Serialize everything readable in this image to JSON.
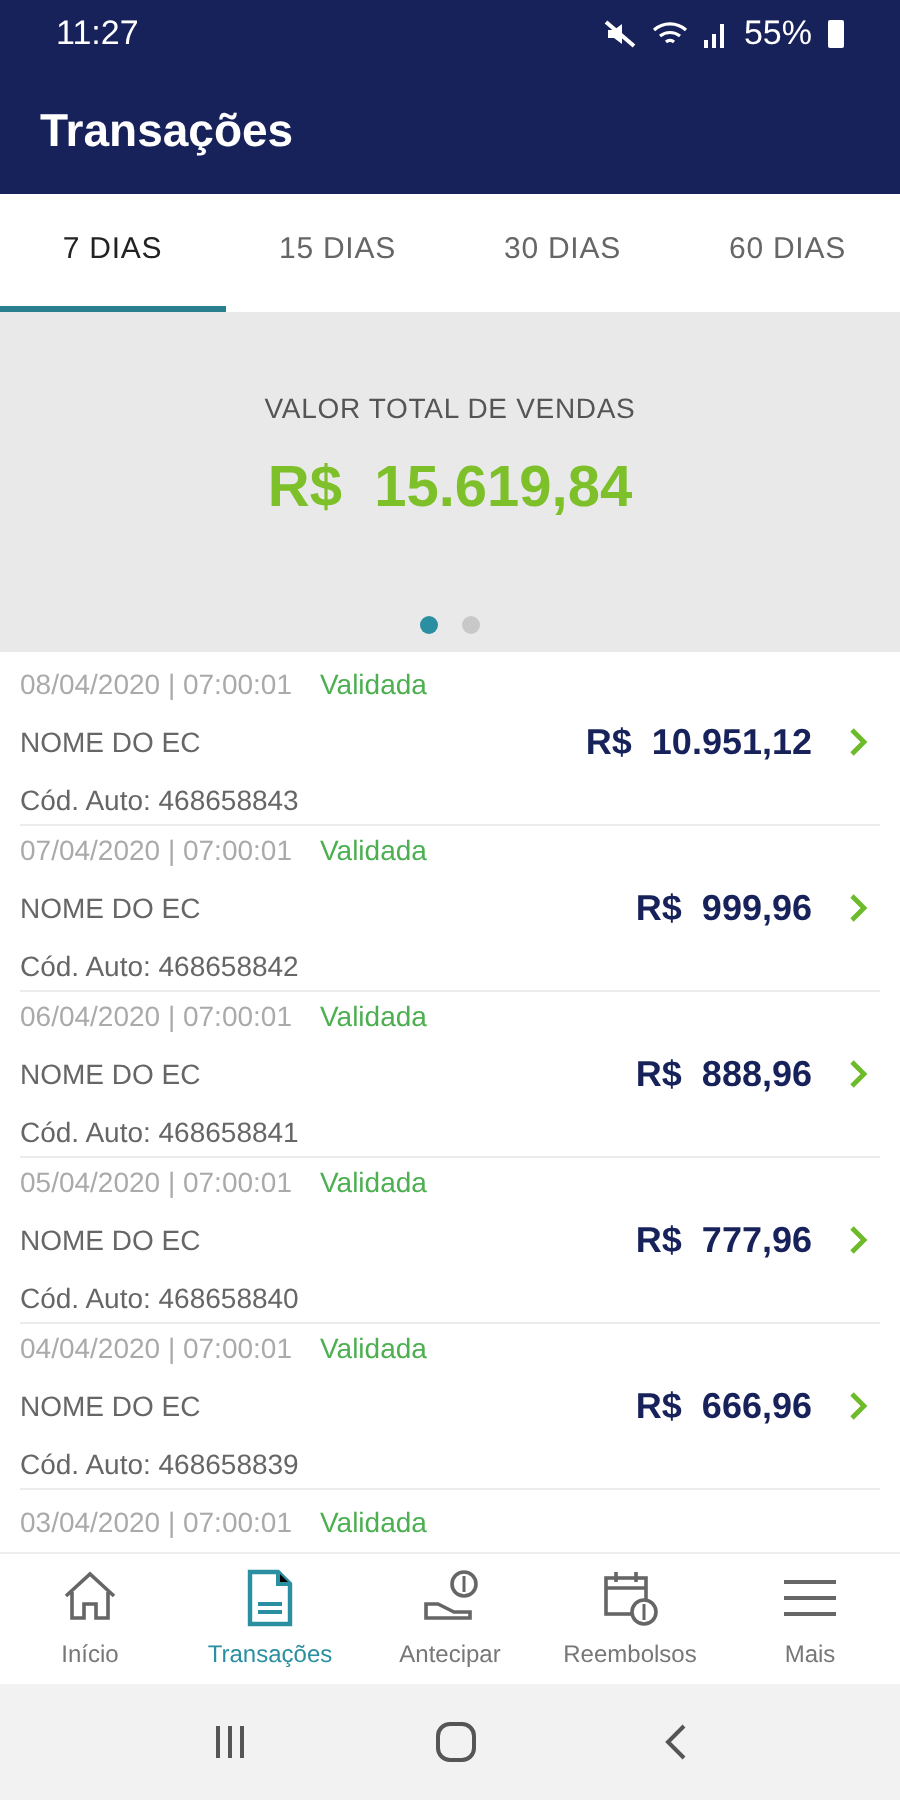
{
  "status_bar": {
    "time": "11:27",
    "battery": "55%"
  },
  "header": {
    "title": "Transações"
  },
  "tabs": [
    {
      "label": "7 DIAS",
      "selected": true
    },
    {
      "label": "15 DIAS",
      "selected": false
    },
    {
      "label": "30 DIAS",
      "selected": false
    },
    {
      "label": "60 DIAS",
      "selected": false
    }
  ],
  "summary": {
    "label": "VALOR TOTAL DE VENDAS",
    "value": "R$  15.619,84",
    "pages": [
      {
        "selected": true
      },
      {
        "selected": false
      }
    ]
  },
  "transactions": [
    {
      "datetime": "08/04/2020 | 07:00:01",
      "status": "Validada",
      "merchant": "NOME DO EC",
      "auth_code": "Cód. Auto: 468658843",
      "amount": "R$  10.951,12"
    },
    {
      "datetime": "07/04/2020 | 07:00:01",
      "status": "Validada",
      "merchant": "NOME DO EC",
      "auth_code": "Cód. Auto: 468658842",
      "amount": "R$  999,96"
    },
    {
      "datetime": "06/04/2020 | 07:00:01",
      "status": "Validada",
      "merchant": "NOME DO EC",
      "auth_code": "Cód. Auto: 468658841",
      "amount": "R$  888,96"
    },
    {
      "datetime": "05/04/2020 | 07:00:01",
      "status": "Validada",
      "merchant": "NOME DO EC",
      "auth_code": "Cód. Auto: 468658840",
      "amount": "R$  777,96"
    },
    {
      "datetime": "04/04/2020 | 07:00:01",
      "status": "Validada",
      "merchant": "NOME DO EC",
      "auth_code": "Cód. Auto: 468658839",
      "amount": "R$  666,96"
    },
    {
      "datetime": "03/04/2020 | 07:00:01",
      "status": "Validada"
    }
  ],
  "bottom_nav": [
    {
      "label": "Início",
      "kind": "home",
      "selected": false
    },
    {
      "label": "Transações",
      "kind": "receipt",
      "selected": true
    },
    {
      "label": "Antecipar",
      "kind": "hand",
      "selected": false
    },
    {
      "label": "Reembolsos",
      "kind": "calendar",
      "selected": false
    },
    {
      "label": "Mais",
      "kind": "menu",
      "selected": false
    }
  ]
}
